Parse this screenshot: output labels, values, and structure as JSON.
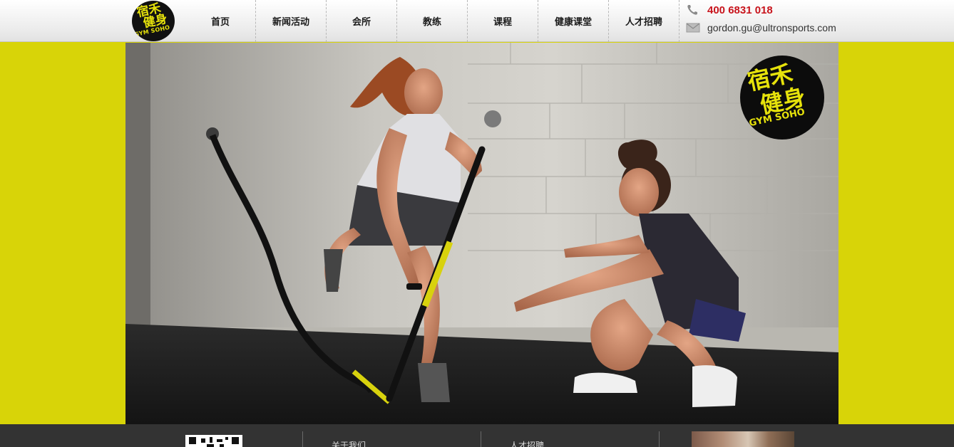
{
  "header": {
    "logo": {
      "line1": "宿禾",
      "line2": "健身",
      "line3": "GYM SOHO"
    },
    "nav": [
      {
        "label": "首页",
        "name": "nav-home"
      },
      {
        "label": "新闻活动",
        "name": "nav-news"
      },
      {
        "label": "会所",
        "name": "nav-club"
      },
      {
        "label": "教练",
        "name": "nav-coach"
      },
      {
        "label": "课程",
        "name": "nav-course"
      },
      {
        "label": "健康课堂",
        "name": "nav-health"
      },
      {
        "label": "人才招聘",
        "name": "nav-jobs"
      }
    ],
    "contact": {
      "phone": "400 6831 018",
      "email": "gordon.gu@ultronsports.com",
      "phone_icon": "phone-icon",
      "email_icon": "mail-icon"
    }
  },
  "hero": {
    "badge": {
      "line1": "宿禾",
      "line2": "健身",
      "line3": "GYM SOHO"
    }
  },
  "footer": {
    "link1": "关于我们",
    "link2": "人才招聘"
  },
  "colors": {
    "background": "#d8d408",
    "accent_yellow": "#e6e20b",
    "phone_red": "#c8141c",
    "footer": "#333333"
  }
}
